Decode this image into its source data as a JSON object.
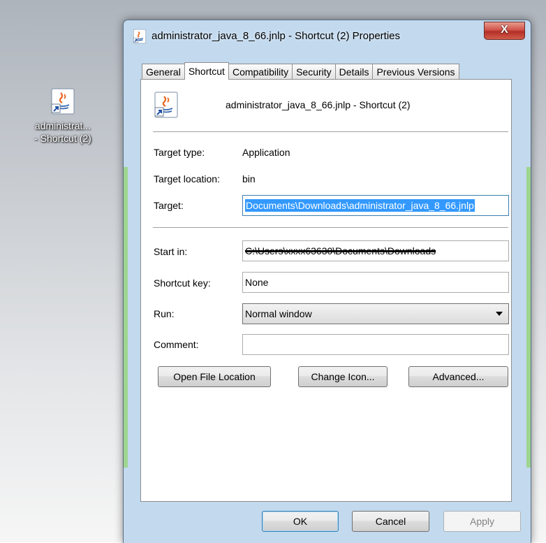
{
  "desktop": {
    "icon_label_line1": "administrat...",
    "icon_label_line2": "- Shortcut (2)"
  },
  "window": {
    "title": "administrator_java_8_66.jnlp - Shortcut (2) Properties",
    "close_label": "X"
  },
  "tabs": [
    {
      "label": "General",
      "active": false
    },
    {
      "label": "Shortcut",
      "active": true
    },
    {
      "label": "Compatibility",
      "active": false
    },
    {
      "label": "Security",
      "active": false
    },
    {
      "label": "Details",
      "active": false
    },
    {
      "label": "Previous Versions",
      "active": false
    }
  ],
  "shortcut": {
    "name": "administrator_java_8_66.jnlp - Shortcut (2)",
    "target_type_label": "Target type:",
    "target_type_value": "Application",
    "target_location_label": "Target location:",
    "target_location_value": "bin",
    "target_label": "Target:",
    "target_value": "Documents\\Downloads\\administrator_java_8_66.jnlp",
    "start_in_label": "Start in:",
    "start_in_value": "C:\\Users\\xxxx63630\\Documents\\Downloads",
    "shortcut_key_label": "Shortcut key:",
    "shortcut_key_value": "None",
    "run_label": "Run:",
    "run_value": "Normal window",
    "comment_label": "Comment:",
    "comment_value": ""
  },
  "buttons": {
    "open_file_location": "Open File Location",
    "change_icon": "Change Icon...",
    "advanced": "Advanced...",
    "ok": "OK",
    "cancel": "Cancel",
    "apply": "Apply"
  },
  "icons": {
    "file": "java-jnlp-shortcut-icon",
    "shortcut_arrow": "shortcut-arrow-icon"
  }
}
